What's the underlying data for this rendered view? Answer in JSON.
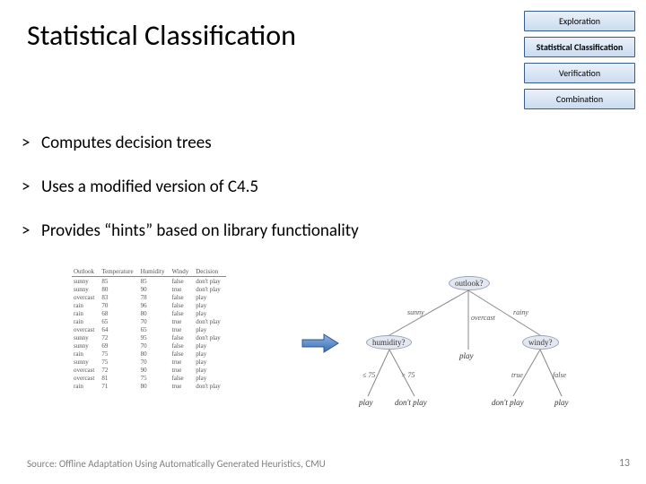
{
  "title": "Statistical Classification",
  "nav": [
    {
      "label": "Exploration",
      "active": false
    },
    {
      "label": "Statistical Classification",
      "active": true
    },
    {
      "label": "Verification",
      "active": false
    },
    {
      "label": "Combination",
      "active": false
    }
  ],
  "bullets": [
    "Computes decision trees",
    "Uses a modified version of C4.5",
    "Provides “hints” based on library functionality"
  ],
  "table": {
    "headers": [
      "Outlook",
      "Temperature",
      "Humidity",
      "Windy",
      "Decision"
    ],
    "rows": [
      [
        "sunny",
        "85",
        "85",
        "false",
        "don't play"
      ],
      [
        "sunny",
        "80",
        "90",
        "true",
        "don't play"
      ],
      [
        "overcast",
        "83",
        "78",
        "false",
        "play"
      ],
      [
        "rain",
        "70",
        "96",
        "false",
        "play"
      ],
      [
        "rain",
        "68",
        "80",
        "false",
        "play"
      ],
      [
        "rain",
        "65",
        "70",
        "true",
        "don't play"
      ],
      [
        "overcast",
        "64",
        "65",
        "true",
        "play"
      ],
      [
        "sunny",
        "72",
        "95",
        "false",
        "don't play"
      ],
      [
        "sunny",
        "69",
        "70",
        "false",
        "play"
      ],
      [
        "rain",
        "75",
        "80",
        "false",
        "play"
      ],
      [
        "sunny",
        "75",
        "70",
        "true",
        "play"
      ],
      [
        "overcast",
        "72",
        "90",
        "true",
        "play"
      ],
      [
        "overcast",
        "81",
        "75",
        "false",
        "play"
      ],
      [
        "rain",
        "71",
        "80",
        "true",
        "don't play"
      ]
    ]
  },
  "tree": {
    "root": "outlook?",
    "edges_root": [
      "sunny",
      "overcast",
      "rainy"
    ],
    "node_left": "humidity?",
    "mid_leaf": "play",
    "node_right": "windy?",
    "edges_left": [
      "≤ 75",
      "> 75"
    ],
    "edges_right": [
      "true",
      "false"
    ],
    "leaf_ll": "play",
    "leaf_lr": "don't play",
    "leaf_rl": "don't play",
    "leaf_rr": "play"
  },
  "footer": "Source: Offline Adaptation Using Automatically Generated Heuristics, CMU",
  "page": "13"
}
